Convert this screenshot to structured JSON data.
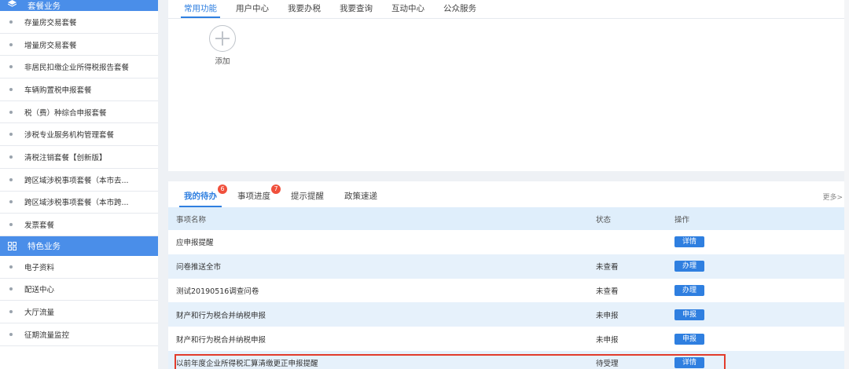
{
  "sidebar": {
    "section1_title": "套餐业务",
    "section1_items": [
      "存量房交易套餐",
      "增量房交易套餐",
      "非居民扣缴企业所得税报告套餐",
      "车辆购置税申报套餐",
      "税（费）种综合申报套餐",
      "涉税专业服务机构管理套餐",
      "清税注销套餐【创新版】",
      "跨区域涉税事项套餐（本市去...",
      "跨区域涉税事项套餐（本市跨...",
      "发票套餐"
    ],
    "section2_title": "特色业务",
    "section2_items": [
      "电子资料",
      "配送中心",
      "大厅流量",
      "征期流量监控"
    ]
  },
  "top_tabs": [
    "常用功能",
    "用户中心",
    "我要办税",
    "我要查询",
    "互动中心",
    "公众服务"
  ],
  "add_label": "添加",
  "bottom_tabs": [
    {
      "label": "我的待办",
      "badge": "6"
    },
    {
      "label": "事项进度",
      "badge": "7"
    },
    {
      "label": "提示提醒",
      "badge": ""
    },
    {
      "label": "政策速递",
      "badge": ""
    }
  ],
  "more_label": "更多>",
  "table": {
    "headers": [
      "事项名称",
      "状态",
      "操作"
    ],
    "rows": [
      {
        "name": "应申报提醒",
        "status": "",
        "action": "详情"
      },
      {
        "name": "问卷推送全市",
        "status": "未查看",
        "action": "办理"
      },
      {
        "name": "测试20190516调查问卷",
        "status": "未查看",
        "action": "办理"
      },
      {
        "name": "财产和行为税合并纳税申报",
        "status": "未申报",
        "action": "申报"
      },
      {
        "name": "财产和行为税合并纳税申报",
        "status": "未申报",
        "action": "申报"
      },
      {
        "name": "以前年度企业所得税汇算清缴更正申报提醒",
        "status": "待受理",
        "action": "详情"
      }
    ]
  },
  "colors": {
    "accent": "#2f7fe0",
    "sidebar_header": "#4a8ee9",
    "badge": "#f0503c",
    "highlight": "#e23c2b"
  }
}
